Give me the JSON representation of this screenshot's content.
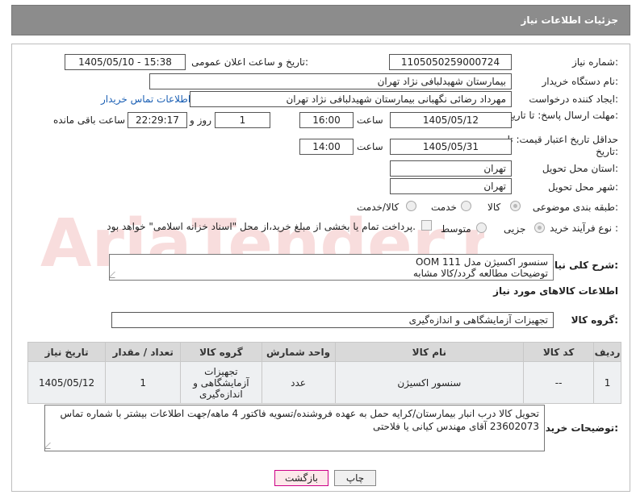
{
  "header": {
    "title": "جزئیات اطلاعات نیاز"
  },
  "form": {
    "need_number_label": "شماره نیاز:",
    "need_number": "1105050259000724",
    "announce_label": "تاریخ و ساعت اعلان عمومی:",
    "announce_value": "1405/05/10 - 15:38",
    "buyer_org_label": "نام دستگاه خریدار:",
    "buyer_org": "بیمارستان شهیدلبافی نژاد تهران",
    "creator_label": "ایجاد کننده درخواست:",
    "creator": "مهرداد رضائی نگهبانی بیمارستان شهیدلبافی نژاد تهران",
    "contact_link": "اطلاعات تماس خریدار",
    "deadline_label": "مهلت ارسال پاسخ: تا تاریخ:",
    "deadline_date": "1405/05/12",
    "time_label": "ساعت",
    "deadline_time": "16:00",
    "days_value": "1",
    "days_label": "روز و",
    "remaining_time": "22:29:17",
    "remaining_label": "ساعت باقی مانده",
    "validity_label": "حداقل تاریخ اعتبار قیمت: تا تاریخ:",
    "validity_date": "1405/05/31",
    "validity_time": "14:00",
    "province_label": "استان محل تحویل:",
    "province": "تهران",
    "city_label": "شهر محل تحویل:",
    "city": "تهران",
    "category_label": "طبقه بندی موضوعی:",
    "category_options": [
      "کالا",
      "خدمت",
      "کالا/خدمت"
    ],
    "process_label": "نوع فرآیند خرید :",
    "process_options": [
      "جزیی",
      "متوسط"
    ],
    "payment_note": "پرداخت تمام یا بخشی از مبلغ خرید،از محل \"اسناد خزانه اسلامی\" خواهد بود."
  },
  "summary": {
    "label": "شرح کلی نیاز:",
    "line1": "سنسور اکسیژن  مدل OOM 111",
    "line2": "توضیحات مطالعه گردد/کالا مشابه"
  },
  "goods_section": {
    "title": "اطلاعات کالاهای مورد نیاز",
    "group_label": "گروه کالا:",
    "group_value": "تجهیزات آزمایشگاهی و اندازه‌گیری"
  },
  "table": {
    "headers": [
      "ردیف",
      "کد کالا",
      "نام کالا",
      "واحد شمارش",
      "گروه کالا",
      "تعداد / مقدار",
      "تاریخ نیاز"
    ],
    "rows": [
      [
        "1",
        "--",
        "سنسور اکسیژن",
        "عدد",
        "تجهیزات آزمایشگاهی و اندازه‌گیری",
        "1",
        "1405/05/12"
      ]
    ]
  },
  "buyer_notes": {
    "label": "توضیحات خریدار:",
    "text": "تحویل کالا درب انبار بیمارستان/کرایه حمل به عهده فروشنده/تسویه فاکتور 4 ماهه/جهت اطلاعات بیشتر با شماره تماس 23602073 آقای مهندس کیانی یا فلاحتی"
  },
  "buttons": {
    "print": "چاپ",
    "back": "بازگشت"
  },
  "watermark": {
    "text": "AriaTender.net"
  }
}
